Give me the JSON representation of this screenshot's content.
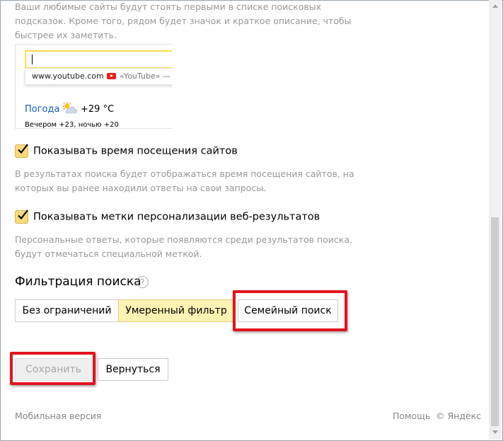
{
  "intro_text_lines": [
    "Ваши любимые сайты будут стоять первыми в списке поисковых",
    "подсказок. Кроме того, рядом будет значок и краткое описание, чтобы",
    "быстрее их заметить."
  ],
  "preview": {
    "suggest_url": "www.youtube.com",
    "suggest_desc": "«YouTube» —",
    "weather_label": "Погода",
    "weather_temp": "+29 °C",
    "weather_forecast": "Вечером +23,  ночью +20"
  },
  "options": [
    {
      "label": "Показывать время посещения сайтов",
      "checked": true,
      "hint_lines": [
        "В результатах поиска будет отображаться время посещения сайтов, на",
        "которых вы ранее находили ответы на свои запросы."
      ]
    },
    {
      "label": "Показывать метки персонализации веб-результатов",
      "checked": true,
      "hint_lines": [
        "Персональные ответы, которые появляются среди результатов поиска,",
        "будут отмечаться специальной меткой."
      ]
    }
  ],
  "filter": {
    "title": "Фильтрация поиска",
    "help": "?",
    "segments": [
      "Без ограничений",
      "Умеренный фильтр",
      "Семейный поиск"
    ],
    "active_index": 1
  },
  "buttons": {
    "save": "Сохранить",
    "back": "Вернуться"
  },
  "footer": {
    "mobile": "Мобильная версия",
    "help": "Помощь",
    "copyright": "© Яндекс"
  },
  "colors": {
    "highlight": "#e3141e",
    "active_segment": "#fff3b4",
    "checkbox": "#fcd97a",
    "link_blue": "#1a5ab3"
  }
}
